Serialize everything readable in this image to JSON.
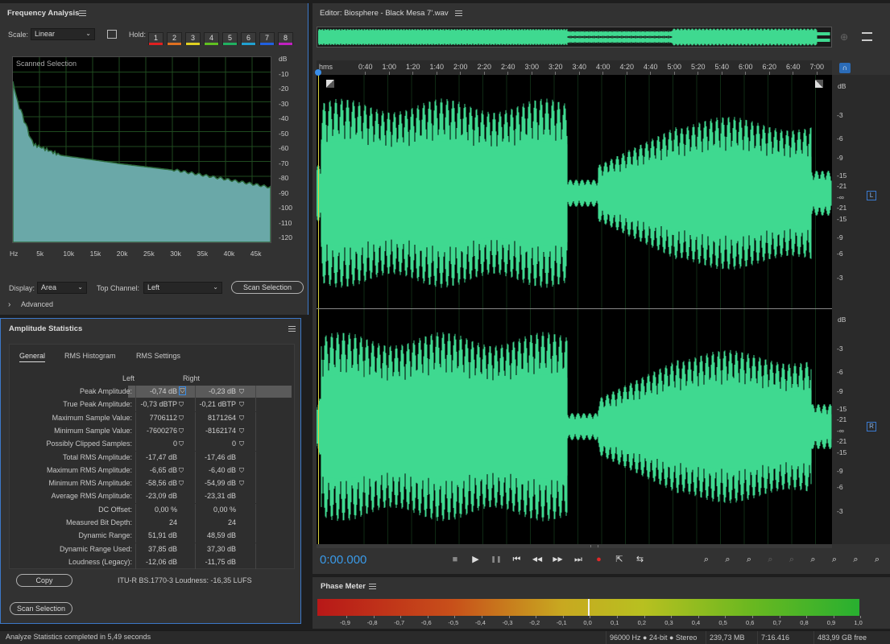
{
  "freq": {
    "title": "Frequency Analysis",
    "scale_label": "Scale:",
    "scale_value": "Linear",
    "hold_label": "Hold:",
    "holds": [
      {
        "label": "1",
        "color": "#e02020"
      },
      {
        "label": "2",
        "color": "#e07020"
      },
      {
        "label": "3",
        "color": "#e0d020"
      },
      {
        "label": "4",
        "color": "#60c020"
      },
      {
        "label": "5",
        "color": "#20b060"
      },
      {
        "label": "6",
        "color": "#20a0d0"
      },
      {
        "label": "7",
        "color": "#2060e0"
      },
      {
        "label": "8",
        "color": "#c020c0"
      }
    ],
    "graph_caption": "Scanned Selection",
    "db_ticks": [
      "dB",
      "-10",
      "-20",
      "-30",
      "-40",
      "-50",
      "-60",
      "-70",
      "-80",
      "-90",
      "-100",
      "-110",
      "-120"
    ],
    "hz_ticks": [
      "Hz",
      "5k",
      "10k",
      "15k",
      "20k",
      "25k",
      "30k",
      "35k",
      "40k",
      "45k"
    ],
    "display_label": "Display:",
    "display_value": "Area",
    "top_channel_label": "Top Channel:",
    "top_channel_value": "Left",
    "scan_button": "Scan Selection",
    "advanced_label": "Advanced"
  },
  "amp": {
    "title": "Amplitude Statistics",
    "tabs": [
      "General",
      "RMS Histogram",
      "RMS Settings"
    ],
    "col_left": "Left",
    "col_right": "Right",
    "rows": [
      {
        "label": "Peak Amplitude:",
        "left": "-0,74 dB",
        "right": "-0,23 dB",
        "pin": true
      },
      {
        "label": "True Peak Amplitude:",
        "left": "-0,73 dBTP",
        "right": "-0,21 dBTP",
        "pin": true
      },
      {
        "label": "Maximum Sample Value:",
        "left": "7706112",
        "right": "8171264",
        "pin": true
      },
      {
        "label": "Minimum Sample Value:",
        "left": "-7600276",
        "right": "-8162174",
        "pin": true
      },
      {
        "label": "Possibly Clipped Samples:",
        "left": "0",
        "right": "0",
        "pin": true
      },
      {
        "label": "Total RMS Amplitude:",
        "left": "-17,47 dB",
        "right": "-17,46 dB",
        "pin": false
      },
      {
        "label": "Maximum RMS Amplitude:",
        "left": "-6,65 dB",
        "right": "-6,40 dB",
        "pin": true
      },
      {
        "label": "Minimum RMS Amplitude:",
        "left": "-58,56 dB",
        "right": "-54,99 dB",
        "pin": true
      },
      {
        "label": "Average RMS Amplitude:",
        "left": "-23,09 dB",
        "right": "-23,31 dB",
        "pin": false
      },
      {
        "label": "DC Offset:",
        "left": "0,00 %",
        "right": "0,00 %",
        "pin": false
      },
      {
        "label": "Measured Bit Depth:",
        "left": "24",
        "right": "24",
        "pin": false
      },
      {
        "label": "Dynamic Range:",
        "left": "51,91 dB",
        "right": "48,59 dB",
        "pin": false
      },
      {
        "label": "Dynamic Range Used:",
        "left": "37,85 dB",
        "right": "37,30 dB",
        "pin": false
      },
      {
        "label": "Loudness (Legacy):",
        "left": "-12,06 dB",
        "right": "-11,75 dB",
        "pin": false
      }
    ],
    "copy_button": "Copy",
    "loudness": "ITU-R BS.1770-3 Loudness: -16,35 LUFS",
    "scan_button": "Scan Selection"
  },
  "editor": {
    "title": "Editor: Biosphere - Black Mesa 7'.wav",
    "time_ticks": [
      "hms",
      "0:40",
      "1:00",
      "1:20",
      "1:40",
      "2:00",
      "2:20",
      "2:40",
      "3:00",
      "3:20",
      "3:40",
      "4:00",
      "4:20",
      "4:40",
      "5:00",
      "5:20",
      "5:40",
      "6:00",
      "6:20",
      "6:40",
      "7:00"
    ],
    "db_ticks_top": [
      "dB",
      "-3",
      "-6",
      "-9",
      "-15",
      "-21",
      "-∞",
      "-21",
      "-15",
      "-9",
      "-6",
      "-3"
    ],
    "db_ticks_bottom": [
      "dB",
      "-3",
      "-6",
      "-9",
      "-15",
      "-21",
      "-∞",
      "-21",
      "-15",
      "-9",
      "-6",
      "-3"
    ],
    "channel_left": "L",
    "channel_right": "R",
    "timecode": "0:00.000",
    "waveform_color": "#3fd990"
  },
  "phase": {
    "title": "Phase Meter",
    "ticks": [
      "-0,9",
      "-0,8",
      "-0,7",
      "-0,6",
      "-0,5",
      "-0,4",
      "-0,3",
      "-0,2",
      "-0,1",
      "0,0",
      "0,1",
      "0,2",
      "0,3",
      "0,4",
      "0,5",
      "0,6",
      "0,7",
      "0,8",
      "0,9",
      "1,0"
    ]
  },
  "status": {
    "message": "Analyze Statistics completed in 5,49 seconds",
    "format": "96000 Hz ● 24-bit ● Stereo",
    "size": "239,73 MB",
    "duration": "7:16.416",
    "free": "483,99 GB free"
  }
}
